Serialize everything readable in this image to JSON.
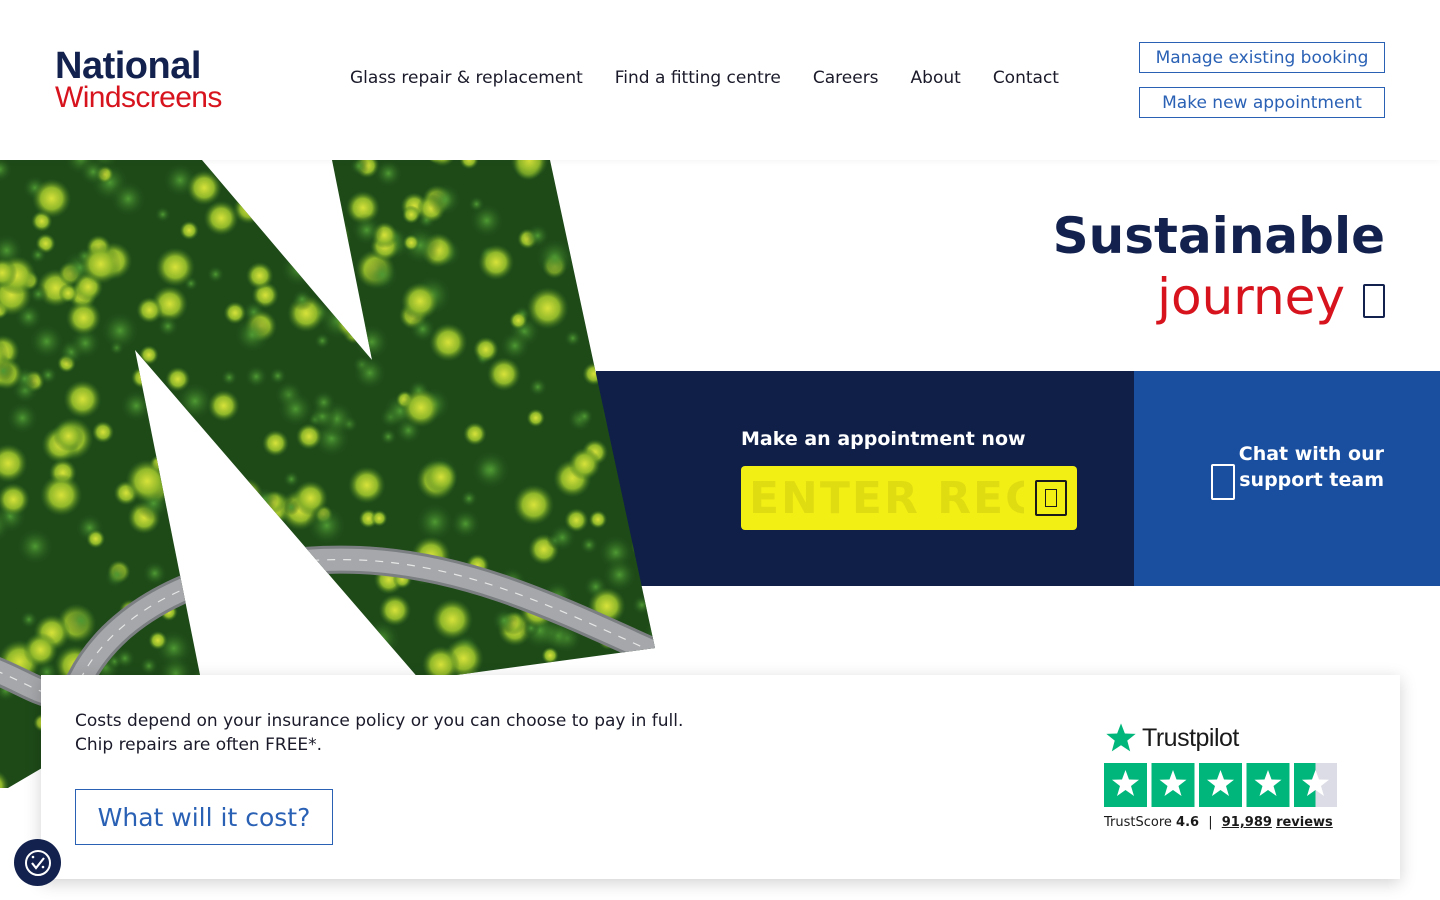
{
  "header": {
    "logo": {
      "line1": "National",
      "line2": "Windscreens"
    },
    "nav": [
      {
        "label": "Glass repair & replacement"
      },
      {
        "label": "Find a fitting centre"
      },
      {
        "label": "Careers"
      },
      {
        "label": "About"
      },
      {
        "label": "Contact"
      }
    ],
    "manage_booking_label": "Manage existing booking",
    "new_appointment_label": "Make new appointment"
  },
  "hero": {
    "headline_line1": "Sustainable",
    "headline_line2": "journey",
    "image_alt": "Aerial view of forest with winding road"
  },
  "appointment": {
    "label": "Make an appointment now",
    "reg_placeholder": "ENTER REG"
  },
  "chat": {
    "label": "Chat with our support team"
  },
  "info_card": {
    "line1": "Costs depend on your insurance policy or you can choose to pay in full.",
    "line2": "Chip repairs are often FREE*.",
    "cost_button": "What will it cost?"
  },
  "trustpilot": {
    "brand": "Trustpilot",
    "score_label": "TrustScore",
    "score": "4.6",
    "separator": "|",
    "reviews_count": "91,989",
    "reviews_label": "reviews",
    "stars_filled": 4.5,
    "star_color": "#00b67a",
    "empty_color": "#dcdce6"
  },
  "colors": {
    "navy": "#12214d",
    "brand_red": "#d7141e",
    "link_blue": "#2a61b5",
    "chat_blue": "#1a4fa0",
    "reg_yellow": "#f2ef15"
  }
}
